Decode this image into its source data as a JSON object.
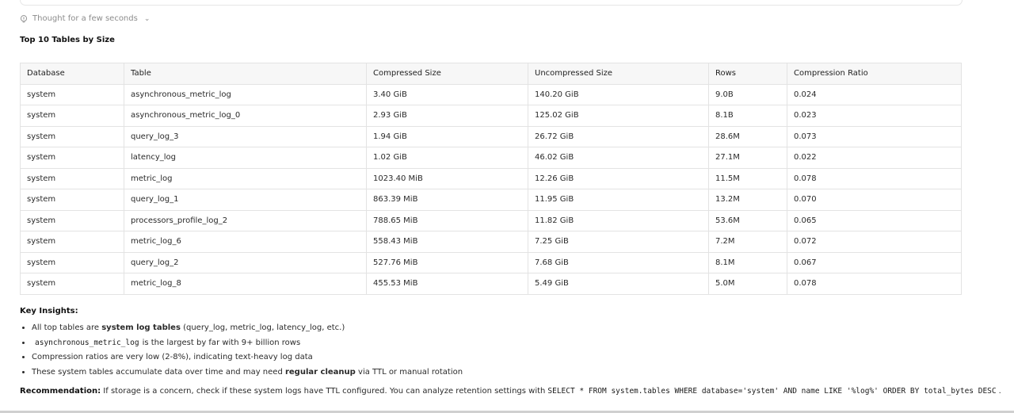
{
  "thought": {
    "label": "Thought for a few seconds",
    "icon": "lightbulb-icon",
    "chevron_icon": "chevron-down-icon"
  },
  "title": "Top 10 Tables by Size",
  "table": {
    "headers": [
      "Database",
      "Table",
      "Compressed Size",
      "Uncompressed Size",
      "Rows",
      "Compression Ratio"
    ],
    "rows": [
      [
        "system",
        "asynchronous_metric_log",
        "3.40 GiB",
        "140.20 GiB",
        "9.0B",
        "0.024"
      ],
      [
        "system",
        "asynchronous_metric_log_0",
        "2.93 GiB",
        "125.02 GiB",
        "8.1B",
        "0.023"
      ],
      [
        "system",
        "query_log_3",
        "1.94 GiB",
        "26.72 GiB",
        "28.6M",
        "0.073"
      ],
      [
        "system",
        "latency_log",
        "1.02 GiB",
        "46.02 GiB",
        "27.1M",
        "0.022"
      ],
      [
        "system",
        "metric_log",
        "1023.40 MiB",
        "12.26 GiB",
        "11.5M",
        "0.078"
      ],
      [
        "system",
        "query_log_1",
        "863.39 MiB",
        "11.95 GiB",
        "13.2M",
        "0.070"
      ],
      [
        "system",
        "processors_profile_log_2",
        "788.65 MiB",
        "11.82 GiB",
        "53.6M",
        "0.065"
      ],
      [
        "system",
        "metric_log_6",
        "558.43 MiB",
        "7.25 GiB",
        "7.2M",
        "0.072"
      ],
      [
        "system",
        "query_log_2",
        "527.76 MiB",
        "7.68 GiB",
        "8.1M",
        "0.067"
      ],
      [
        "system",
        "metric_log_8",
        "455.53 MiB",
        "5.49 GiB",
        "5.0M",
        "0.078"
      ]
    ]
  },
  "insights": {
    "title": "Key Insights:",
    "item1_pre": "All top tables are ",
    "item1_bold": "system log tables",
    "item1_post": " (query_log, metric_log, latency_log, etc.)",
    "item2_code": "asynchronous_metric_log",
    "item2_post": "is the largest by far with 9+ billion rows",
    "item3": "Compression ratios are very low (2-8%), indicating text-heavy log data",
    "item4_pre": "These system tables accumulate data over time and may need ",
    "item4_bold": "regular cleanup",
    "item4_post": " via TTL or manual rotation"
  },
  "recommendation": {
    "label": "Recommendation:",
    "text": " If storage is a concern, check if these system logs have TTL configured. You can analyze retention settings with",
    "code": "SELECT * FROM system.tables WHERE database='system' AND name LIKE '%log%' ORDER BY total_bytes DESC",
    "end": "."
  }
}
